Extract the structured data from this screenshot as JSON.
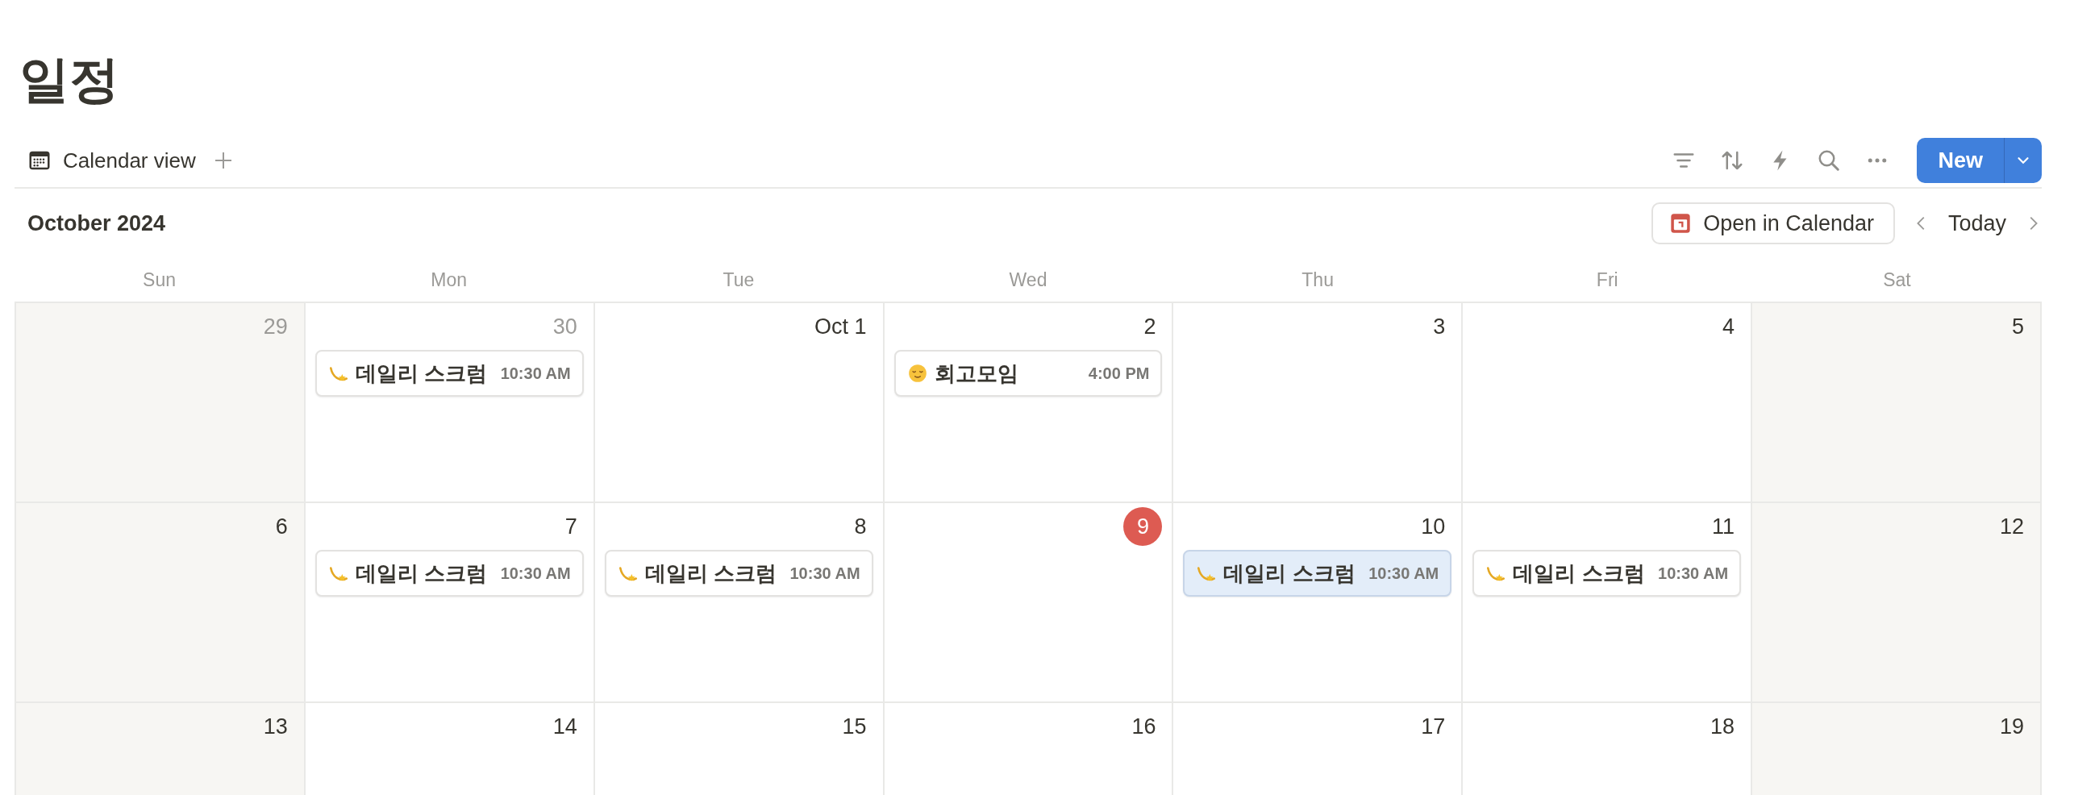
{
  "page": {
    "title": "일정"
  },
  "view_tabs": [
    {
      "label": "Calendar view",
      "selected": true
    }
  ],
  "toolbar": {
    "new_button": "New"
  },
  "calendar": {
    "month": "October 2024",
    "open_button": "Open in Calendar",
    "today_button": "Today",
    "weekdays": [
      "Sun",
      "Mon",
      "Tue",
      "Wed",
      "Thu",
      "Fri",
      "Sat"
    ],
    "weeks": [
      [
        {
          "day": "29",
          "in_month": false,
          "today": false
        },
        {
          "day": "30",
          "in_month": false,
          "today": false,
          "events": [
            {
              "title": "데일리 스크럼",
              "time": "10:30 AM",
              "kind": "sparkle",
              "selected": false
            }
          ]
        },
        {
          "day": "Oct 1",
          "in_month": true,
          "today": false
        },
        {
          "day": "2",
          "in_month": true,
          "today": false,
          "events": [
            {
              "title": "회고모임",
              "time": "4:00 PM",
              "kind": "face",
              "selected": false
            }
          ]
        },
        {
          "day": "3",
          "in_month": true,
          "today": false
        },
        {
          "day": "4",
          "in_month": true,
          "today": false
        },
        {
          "day": "5",
          "in_month": true,
          "today": false
        }
      ],
      [
        {
          "day": "6",
          "in_month": true,
          "today": false
        },
        {
          "day": "7",
          "in_month": true,
          "today": false,
          "events": [
            {
              "title": "데일리 스크럼",
              "time": "10:30 AM",
              "kind": "sparkle",
              "selected": false
            }
          ]
        },
        {
          "day": "8",
          "in_month": true,
          "today": false,
          "events": [
            {
              "title": "데일리 스크럼",
              "time": "10:30 AM",
              "kind": "sparkle",
              "selected": false
            }
          ]
        },
        {
          "day": "9",
          "in_month": true,
          "today": true
        },
        {
          "day": "10",
          "in_month": true,
          "today": false,
          "events": [
            {
              "title": "데일리 스크럼",
              "time": "10:30 AM",
              "kind": "sparkle",
              "selected": true
            }
          ]
        },
        {
          "day": "11",
          "in_month": true,
          "today": false,
          "events": [
            {
              "title": "데일리 스크럼",
              "time": "10:30 AM",
              "kind": "sparkle",
              "selected": false
            }
          ]
        },
        {
          "day": "12",
          "in_month": true,
          "today": false
        }
      ],
      [
        {
          "day": "13",
          "in_month": true,
          "today": false
        },
        {
          "day": "14",
          "in_month": true,
          "today": false
        },
        {
          "day": "15",
          "in_month": true,
          "today": false
        },
        {
          "day": "16",
          "in_month": true,
          "today": false
        },
        {
          "day": "17",
          "in_month": true,
          "today": false
        },
        {
          "day": "18",
          "in_month": true,
          "today": false
        },
        {
          "day": "19",
          "in_month": true,
          "today": false
        }
      ]
    ]
  }
}
